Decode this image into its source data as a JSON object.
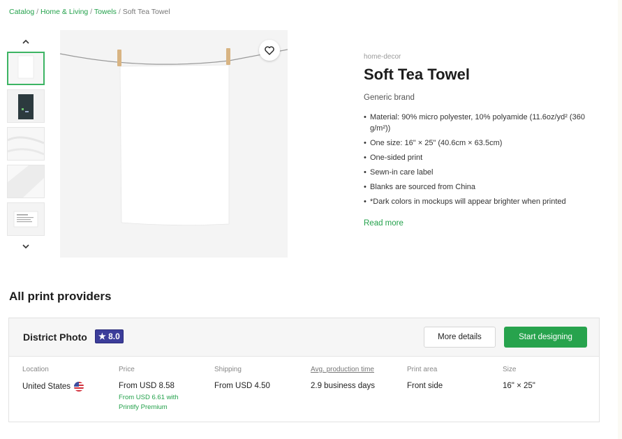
{
  "breadcrumb": {
    "items": [
      "Catalog",
      "Home & Living",
      "Towels"
    ],
    "current": "Soft Tea Towel",
    "separator": "/"
  },
  "gallery": {
    "up_icon": "chevron-up-icon",
    "down_icon": "chevron-down-icon",
    "favorite_icon": "heart-icon"
  },
  "product": {
    "category": "home-decor",
    "title": "Soft Tea Towel",
    "brand": "Generic brand",
    "features": [
      "Material: 90% micro polyester, 10% polyamide (11.6oz/yd² (360 g/m²))",
      "One size: 16\" × 25\" (40.6cm × 63.5cm)",
      "One-sided print",
      "Sewn-in care label",
      "Blanks are sourced from China",
      "*Dark colors in mockups will appear brighter when printed"
    ],
    "read_more": "Read more"
  },
  "providers": {
    "title": "All print providers",
    "items": [
      {
        "name": "District Photo",
        "rating": "★ 8.0",
        "details_label": "More details",
        "start_label": "Start designing",
        "location_label": "Location",
        "location": "United States",
        "price_label": "Price",
        "price": "From USD 8.58",
        "premium_price": "From USD 6.61 with Printify Premium",
        "shipping_label": "Shipping",
        "shipping": "From USD 4.50",
        "production_label": "Avg. production time",
        "production": "2.9 business days",
        "print_area_label": "Print area",
        "print_area": "Front side",
        "size_label": "Size",
        "size": "16\" × 25\""
      }
    ]
  },
  "colors": {
    "accent": "#27a34d",
    "rating_badge": "#3c3d9a"
  }
}
